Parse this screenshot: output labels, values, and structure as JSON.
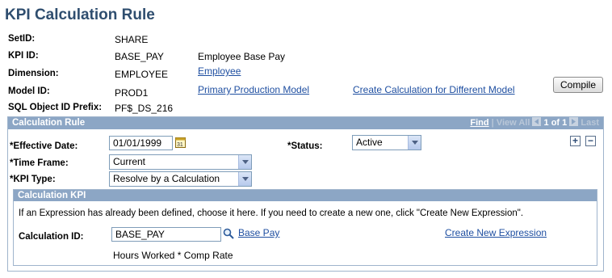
{
  "page": {
    "title": "KPI Calculation Rule"
  },
  "header_fields": {
    "setid": {
      "label": "SetID:",
      "value": "SHARE"
    },
    "kpi_id": {
      "label": "KPI ID:",
      "value": "BASE_PAY",
      "description": "Employee Base Pay"
    },
    "dimension": {
      "label": "Dimension:",
      "value": "EMPLOYEE",
      "link": "Employee"
    },
    "model_id": {
      "label": "Model ID:",
      "value": "PROD1",
      "link": "Primary Production Model",
      "alt_link": "Create Calculation for Different Model"
    },
    "sql_prefix": {
      "label": "SQL Object ID Prefix:",
      "value": "PF$_DS_216"
    }
  },
  "compile_button": "Compile",
  "calc_rule": {
    "header": "Calculation Rule",
    "nav": {
      "find": "Find",
      "view_all": "View All",
      "sep": "|",
      "counter": "1 of 1",
      "last": "Last"
    },
    "effective_date": {
      "label": "*Effective Date:",
      "value": "01/01/1999"
    },
    "status": {
      "label": "*Status:",
      "value": "Active"
    },
    "time_frame": {
      "label": "*Time Frame:",
      "value": "Current"
    },
    "kpi_type": {
      "label": "*KPI Type:",
      "value": "Resolve by a Calculation"
    },
    "add_row": "+",
    "delete_row": "−"
  },
  "calc_kpi": {
    "header": "Calculation KPI",
    "instructions": "If an Expression has already been defined, choose it here. If you need to create a new one, click \"Create New Expression\".",
    "calc_id": {
      "label": "Calculation ID:",
      "value": "BASE_PAY",
      "link": "Base Pay"
    },
    "create_link": "Create New Expression",
    "expression": "Hours Worked * Comp Rate"
  },
  "icons": {
    "calendar": "calendar-icon",
    "lookup": "magnifier-icon",
    "first": "first-arrow-icon",
    "next": "next-arrow-icon"
  }
}
